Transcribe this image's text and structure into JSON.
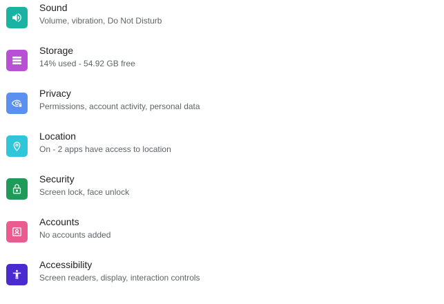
{
  "settings": {
    "items": [
      {
        "title": "Sound",
        "summary": "Volume, vibration, Do Not Disturb",
        "icon": "volume-icon",
        "color": "#18b3a3"
      },
      {
        "title": "Storage",
        "summary": "14% used - 54.92 GB free",
        "icon": "storage-icon",
        "color": "#b94fd6"
      },
      {
        "title": "Privacy",
        "summary": "Permissions, account activity, personal data",
        "icon": "privacy-eye-lock-icon",
        "color": "#5b8ff0"
      },
      {
        "title": "Location",
        "summary": "On - 2 apps have access to location",
        "icon": "location-pin-icon",
        "color": "#2ec6d8"
      },
      {
        "title": "Security",
        "summary": "Screen lock, face unlock",
        "icon": "lock-icon",
        "color": "#1f9a58"
      },
      {
        "title": "Accounts",
        "summary": "No accounts added",
        "icon": "account-box-icon",
        "color": "#ec5b8f"
      },
      {
        "title": "Accessibility",
        "summary": "Screen readers, display, interaction controls",
        "icon": "accessibility-icon",
        "color": "#4a2bcf"
      }
    ]
  }
}
